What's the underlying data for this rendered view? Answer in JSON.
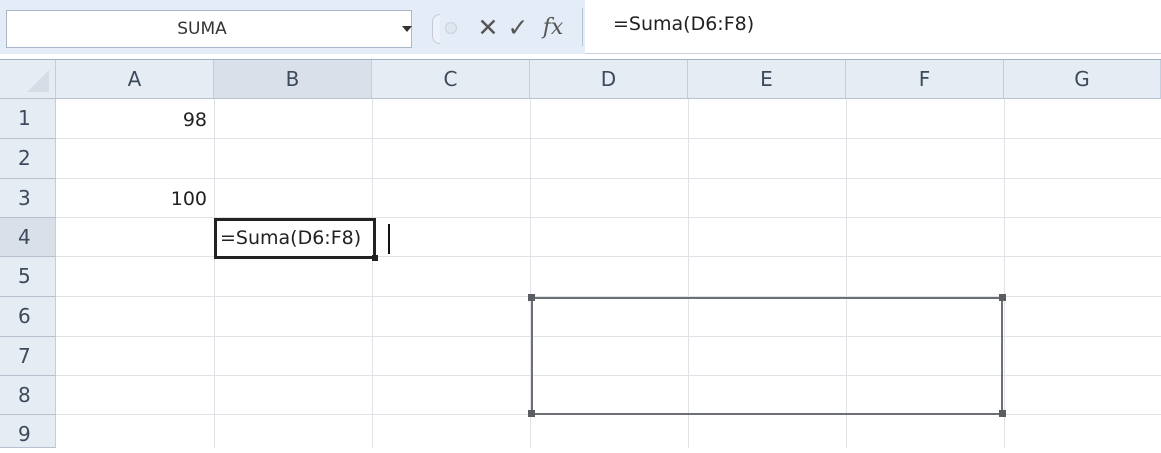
{
  "formula_bar": {
    "name_box": "SUMA",
    "cancel_icon": "✕",
    "enter_icon": "✓",
    "fx_label": "fx",
    "formula": "=Suma(D6:F8)"
  },
  "columns": [
    "A",
    "B",
    "C",
    "D",
    "E",
    "F",
    "G"
  ],
  "rows": [
    "1",
    "2",
    "3",
    "4",
    "5",
    "6",
    "7",
    "8",
    "9"
  ],
  "cells": {
    "A1": "98",
    "A3": "100"
  },
  "active_cell": {
    "ref": "B4",
    "edit_text": "=Suma(D6:F8)"
  },
  "reference_range": "D6:F8",
  "colors": {
    "header_bg": "#e6ecf4",
    "gridline": "#dfe3e8",
    "range_border": "#6c6f74"
  }
}
